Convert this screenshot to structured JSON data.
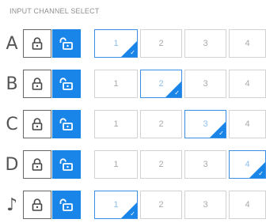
{
  "title": "INPUT CHANNEL SELECT",
  "channels": [
    "1",
    "2",
    "3",
    "4"
  ],
  "rows": [
    {
      "label": "A",
      "selected": "1"
    },
    {
      "label": "B",
      "selected": "2"
    },
    {
      "label": "C",
      "selected": "3"
    },
    {
      "label": "D",
      "selected": "4"
    },
    {
      "label": "♪",
      "selected": "1"
    }
  ],
  "icons": {
    "locked": "lock-closed-icon",
    "unlocked": "lock-open-icon",
    "selected_marker": "checkmark-icon"
  },
  "colors": {
    "accent": "#1a85e8",
    "selected_border": "#3b8fe5",
    "selected_text": "#8ec0ef",
    "cell_border": "#d2d2d2",
    "cell_text": "#aaaaaa"
  }
}
